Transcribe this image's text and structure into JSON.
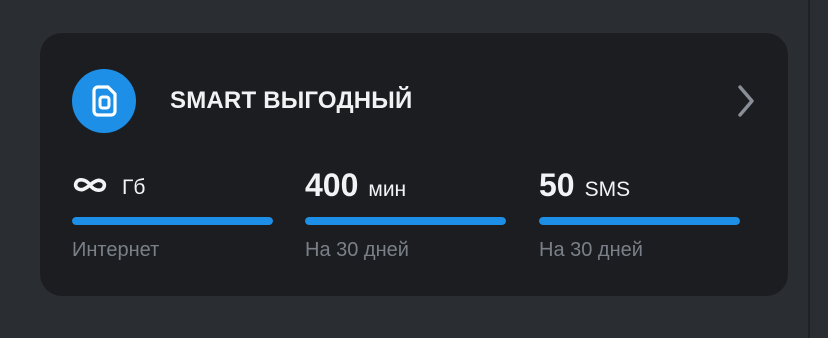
{
  "plan": {
    "title": "SMART ВЫГОДНЫЙ",
    "icon": "sim-card-icon",
    "accent_color": "#1e8fe7"
  },
  "stats": [
    {
      "value": "∞",
      "value_icon": "infinity-icon",
      "unit": "Гб",
      "subtitle": "Интернет",
      "remaining_fraction": 1.0
    },
    {
      "value": "400",
      "unit": "мин",
      "subtitle": "На 30 дней",
      "remaining_fraction": 1.0
    },
    {
      "value": "50",
      "unit": "SMS",
      "subtitle": "На 30 дней",
      "remaining_fraction": 1.0
    }
  ]
}
